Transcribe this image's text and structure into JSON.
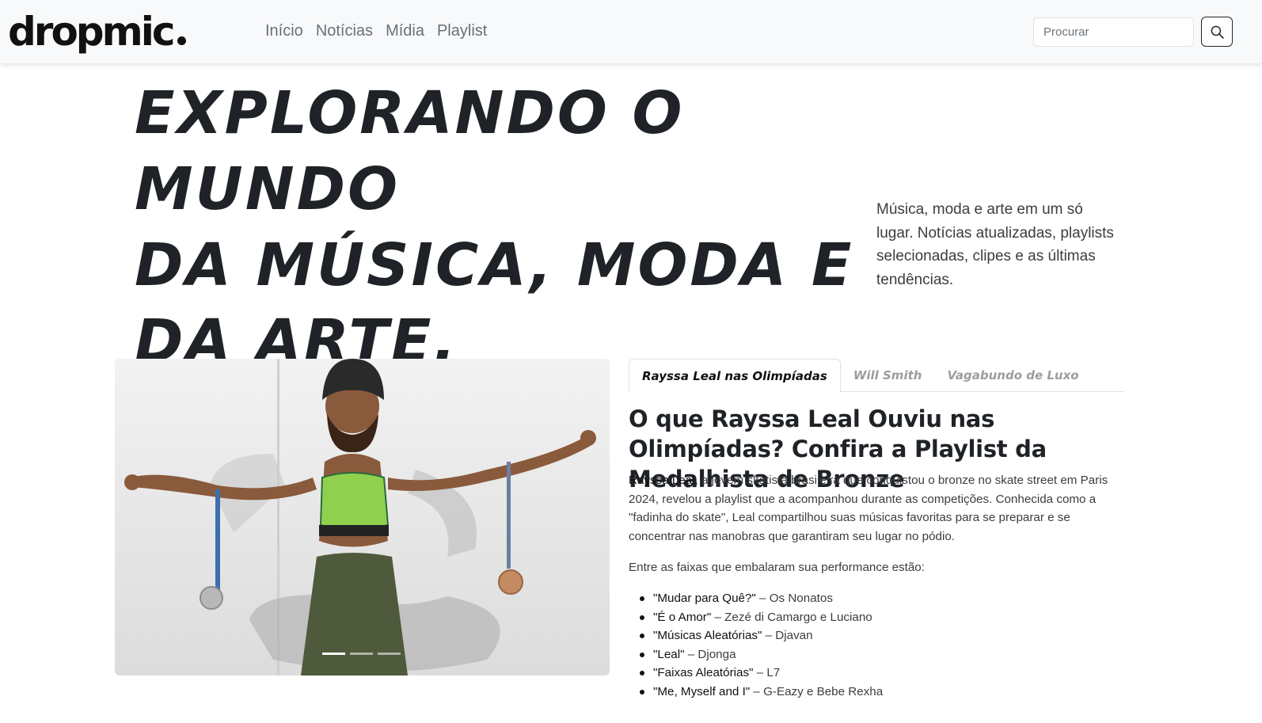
{
  "brand": {
    "logo_text": "dropmic"
  },
  "nav": {
    "links": [
      "Início",
      "Notícias",
      "Mídia",
      "Playlist"
    ]
  },
  "search": {
    "placeholder": "Procurar",
    "button_icon": "search-icon"
  },
  "hero": {
    "title_lines": [
      "EXPLORANDO O MUNDO",
      "DA MÚSICA, MODA E",
      "DA ARTE."
    ],
    "lead": "Música, moda e arte em um só lugar. Notícias atualizadas, playlists selecionadas, clipes e as últimas tendências."
  },
  "carousel": {
    "slide_count": 3,
    "active_index": 0,
    "image": "skater-with-medals-photo"
  },
  "tabs": {
    "items": [
      "Rayssa Leal nas Olimpíadas",
      "Will Smith",
      "Vagabundo de Luxo"
    ],
    "active_index": 0
  },
  "article": {
    "title": "O que Rayssa Leal Ouviu nas Olimpíadas? Confira a Playlist da Medalhista de Bronze",
    "p1_name": "Rayssa Leal",
    "p1_rest": ", a jovem skatista brasileira que conquistou o bronze no skate street em Paris 2024, revelou a playlist que a acompanhou durante as competições. Conhecida como a \"fadinha do skate\", Leal compartilhou suas músicas favoritas para se preparar e se concentrar nas manobras que garantiram seu lugar no pódio.",
    "p2": "Entre as faixas que embalaram sua performance estão:",
    "tracks": [
      {
        "song": "\"Mudar para Quê?\"",
        "artist": " – Os Nonatos"
      },
      {
        "song": "\"É o Amor\"",
        "artist": " – Zezé di Camargo e Luciano"
      },
      {
        "song": "\"Músicas Aleatórias\"",
        "artist": " – Djavan"
      },
      {
        "song": "\"Leal\"",
        "artist": " – Djonga"
      },
      {
        "song": "\"Faixas Aleatórias\"",
        "artist": " – L7"
      },
      {
        "song": "\"Me, Myself and I\"",
        "artist": " – G-Eazy e Bebe Rexha"
      }
    ]
  },
  "colors": {
    "navbar_bg": "#f8f9fa",
    "text_dark": "#1f2226",
    "text_muted": "#6c6f73",
    "tab_inactive": "#9a9da1"
  }
}
